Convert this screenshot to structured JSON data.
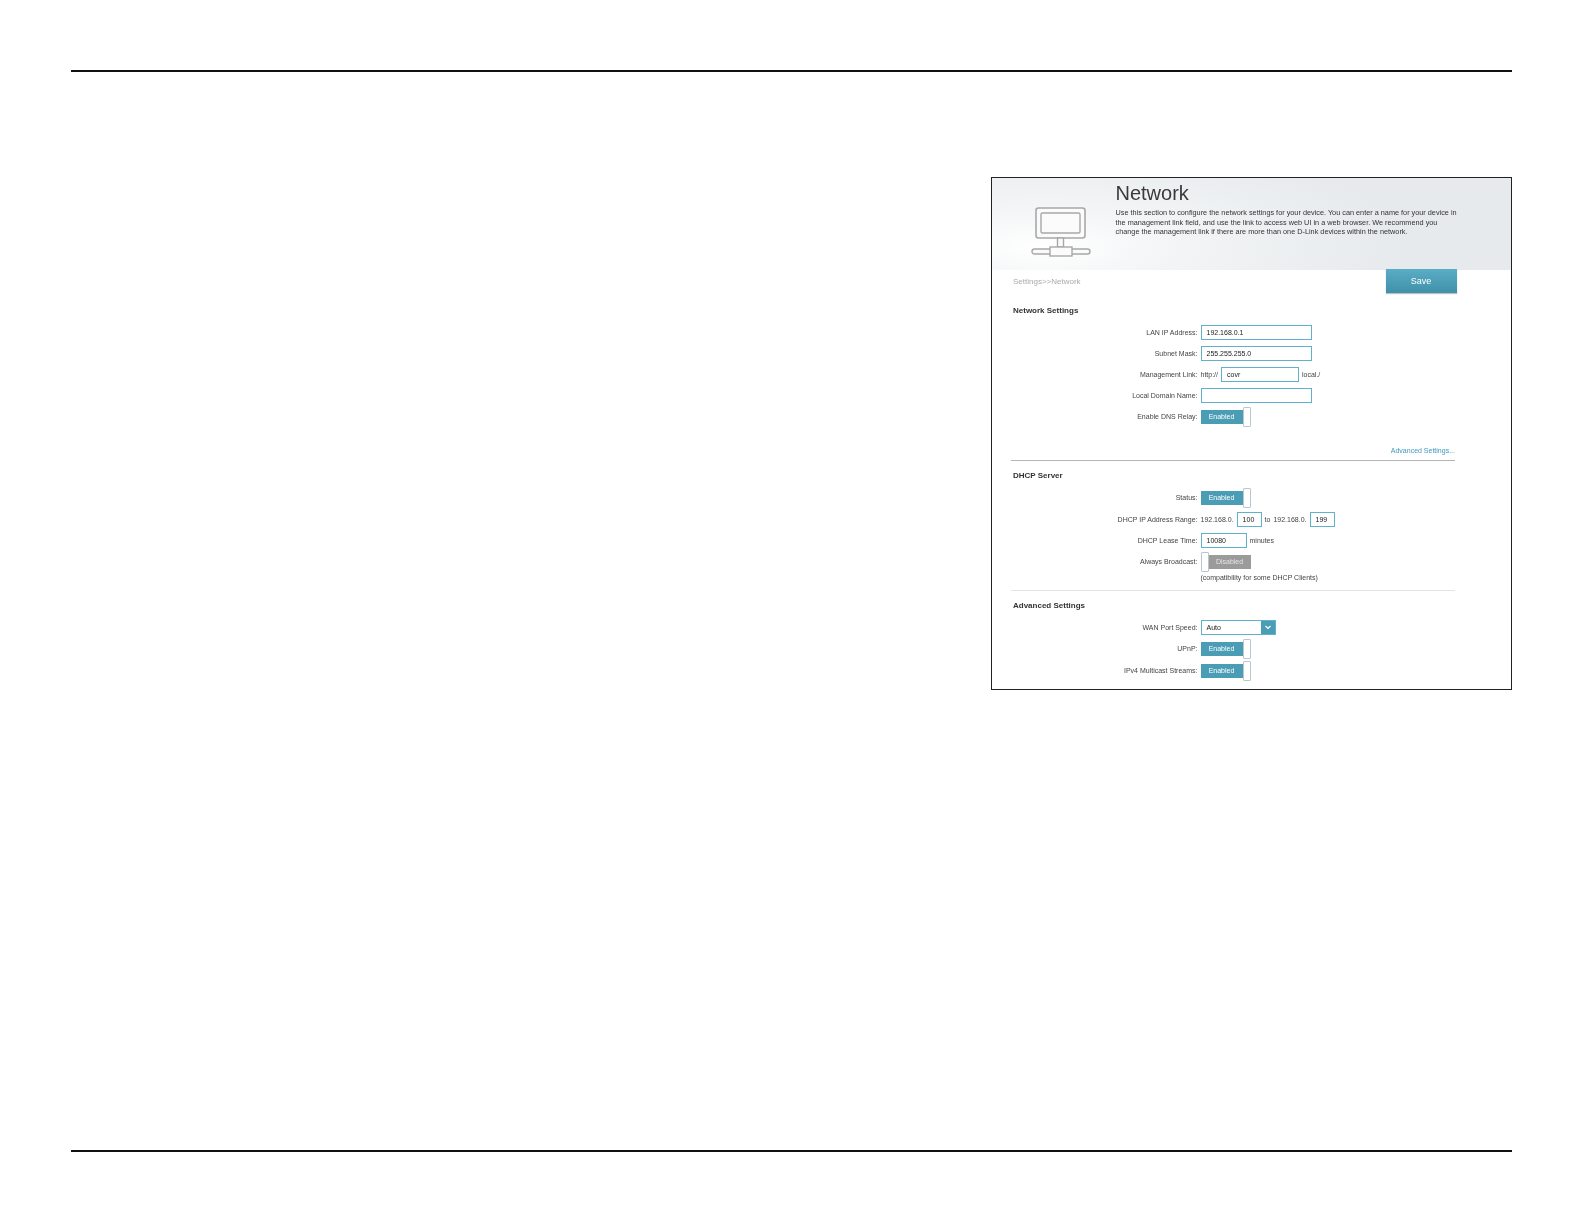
{
  "header": {
    "title": "Network",
    "description": "Use this section to configure the network settings for your device. You can enter a name for your device in the management link field, and use the link to access web UI in a web browser. We recommend you change the management link if there are more than one D-Link devices within the network."
  },
  "toolbar": {
    "breadcrumb": "Settings>>Network",
    "save_button": "Save"
  },
  "sections": [
    {
      "title": "Network Settings",
      "rows": [
        {
          "kind": "text",
          "label": "LAN IP Address:",
          "value": "192.168.0.1"
        },
        {
          "kind": "text",
          "label": "Subnet Mask:",
          "value": "255.255.255.0"
        },
        {
          "kind": "link",
          "label": "Management Link:",
          "prefix": "http://",
          "value": "covr",
          "suffix": "local./"
        },
        {
          "kind": "text",
          "label": "Local Domain Name:"
        },
        {
          "kind": "toggle",
          "label": "Enable DNS Relay:",
          "on": true,
          "state_text": "Enabled"
        }
      ],
      "link": "Advanced Settings..."
    },
    {
      "title": "DHCP Server",
      "rows": [
        {
          "kind": "toggle",
          "label": "Status:",
          "on": true,
          "state_text": "Enabled"
        },
        {
          "kind": "range",
          "label": "DHCP IP Address Range:",
          "start_prefix": "192.168.0.",
          "start": "100",
          "separator": "to",
          "end_prefix": "192.168.0.",
          "end": "199"
        },
        {
          "kind": "text",
          "label": "DHCP Lease Time:",
          "value": "10080",
          "suffix": "minutes"
        },
        {
          "kind": "toggle",
          "label": "Always Broadcast:",
          "on": false,
          "state_text": "Disabled",
          "note": "(compatibility for some DHCP Clients)"
        }
      ]
    },
    {
      "title": "Advanced Settings",
      "rows": [
        {
          "kind": "select",
          "label": "WAN Port Speed:",
          "value": "Auto"
        },
        {
          "kind": "toggle",
          "label": "UPnP:",
          "on": true,
          "state_text": "Enabled"
        },
        {
          "kind": "toggle",
          "label": "IPv4 Multicast Streams:",
          "on": true,
          "state_text": "Enabled"
        }
      ]
    }
  ]
}
